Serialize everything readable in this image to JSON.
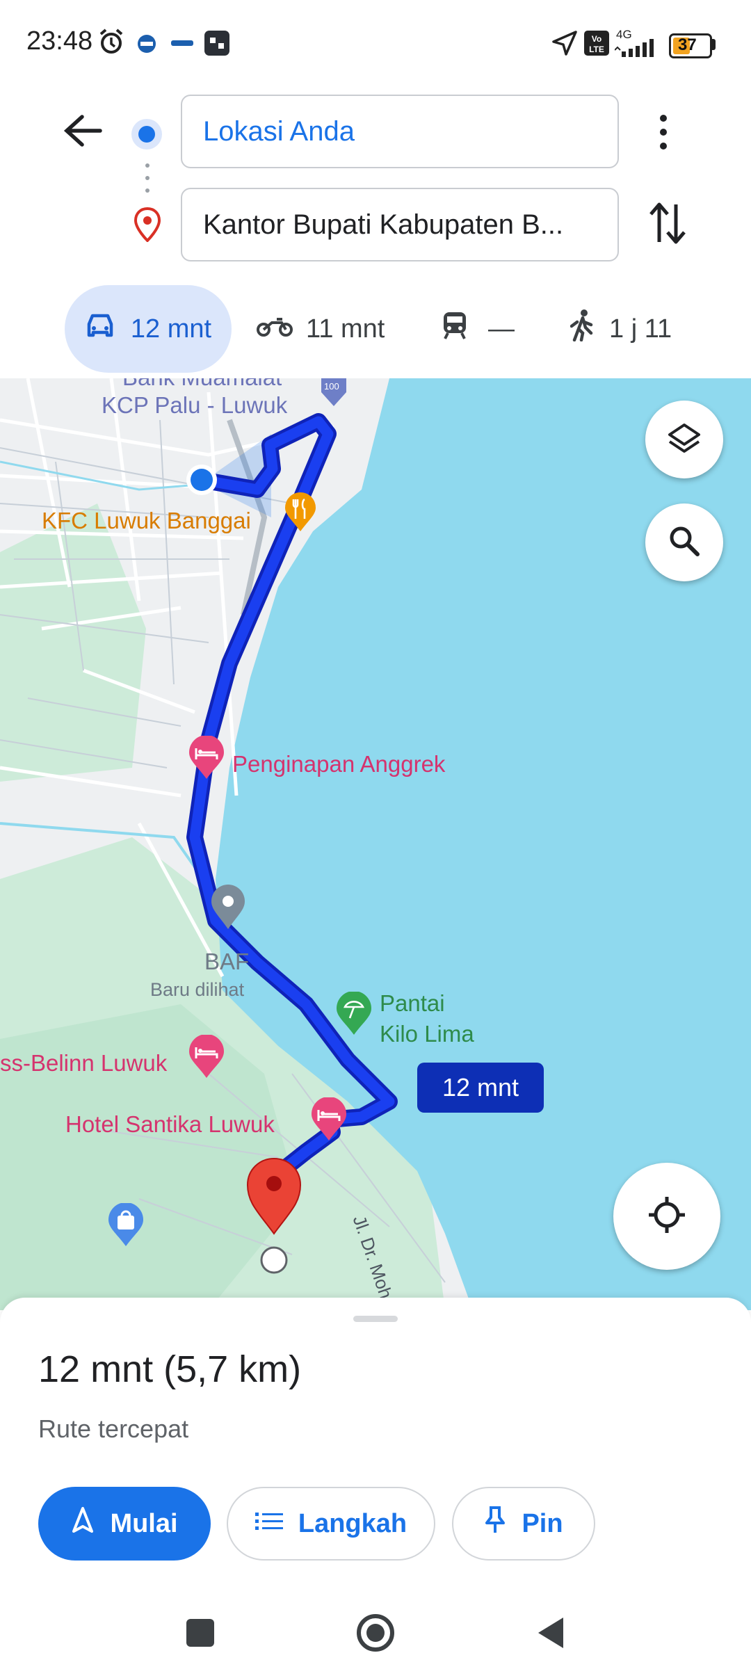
{
  "status_bar": {
    "time": "23:48",
    "battery": "37",
    "network": "4G",
    "icons": [
      "alarm-icon",
      "app-icon",
      "app-icon",
      "app-icon",
      "location-arrow-icon",
      "volte-icon",
      "signal-icon",
      "battery-icon"
    ]
  },
  "header": {
    "origin": "Lokasi Anda",
    "destination": "Kantor Bupati Kabupaten B...",
    "icons": [
      "back-arrow-icon",
      "origin-dot-icon",
      "destination-pin-icon",
      "more-vert-icon",
      "swap-icon"
    ]
  },
  "modes": [
    {
      "name": "car",
      "label": "12 mnt",
      "active": true
    },
    {
      "name": "motorcycle",
      "label": "11 mnt",
      "active": false
    },
    {
      "name": "transit",
      "label": "—",
      "active": false
    },
    {
      "name": "walk",
      "label": "1 j 11",
      "active": false
    }
  ],
  "map": {
    "labels": {
      "bank_top": "Bank Muamalat",
      "bank": "KCP Palu - Luwuk",
      "road_badge": "100",
      "kfc": "KFC Luwuk Banggai",
      "penginapan": "Penginapan Anggrek",
      "baf": "BAF",
      "baru": "Baru dilihat",
      "pantai_1": "Pantai",
      "pantai_2": "Kilo Lima",
      "belinn": "ss-Belinn Luwuk",
      "santika": "Hotel Santika Luwuk",
      "street": "Jl. Dr. Moh. Hatta"
    },
    "eta_chip": "12 mnt",
    "colors": {
      "water": "#8fd9ee",
      "route": "#1a33e8",
      "land": "#eef0f2",
      "park": "#cdebd9"
    }
  },
  "sheet": {
    "summary": "12 mnt (5,7 km)",
    "subtitle": "Rute tercepat",
    "buttons": {
      "start": "Mulai",
      "steps": "Langkah",
      "pin": "Pin"
    }
  },
  "navbar": {
    "icons": [
      "recents-square-icon",
      "home-circle-icon",
      "back-triangle-icon"
    ]
  }
}
